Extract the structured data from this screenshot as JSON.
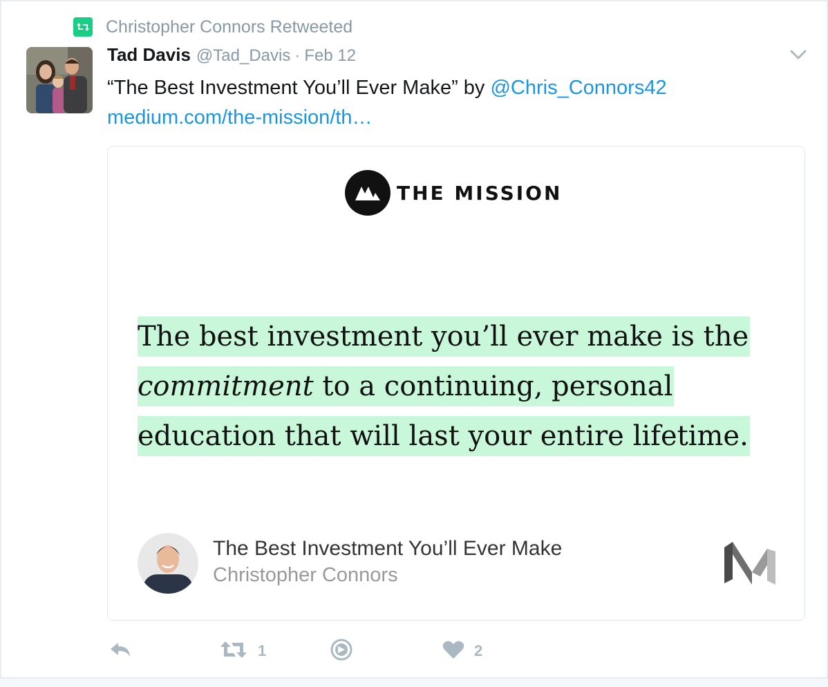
{
  "context": {
    "icon": "retweet-icon",
    "text": "Christopher Connors Retweeted",
    "color": "#19cf86"
  },
  "tweet": {
    "name": "Tad Davis",
    "handle": "@Tad_Davis",
    "separator": "·",
    "date": "Feb 12",
    "text_before": "“The Best Investment You’ll Ever Make” by ",
    "mention": "@Chris_Connors42",
    "link": "medium.com/the-mission/th…"
  },
  "card": {
    "publication": "THE MISSION",
    "quote": {
      "line1": "The best investment you’ll ever make is the",
      "line2_italic": "commitment",
      "line2_rest": " to a continuing, personal",
      "line3": "education that will last your entire lifetime."
    },
    "highlight_color": "#c9f7d9",
    "article_title": "The Best Investment You’ll Ever Make",
    "article_author": "Christopher Connors",
    "source_icon": "medium-logo-icon"
  },
  "actions": {
    "reply_icon": "reply-icon",
    "retweet_icon": "retweet-icon",
    "retweet_count": "1",
    "dm_icon": "direct-message-icon",
    "like_icon": "heart-icon",
    "like_count": "2"
  },
  "colors": {
    "link": "#1b95e0",
    "muted": "#8899a6",
    "action": "#aab8c2"
  }
}
